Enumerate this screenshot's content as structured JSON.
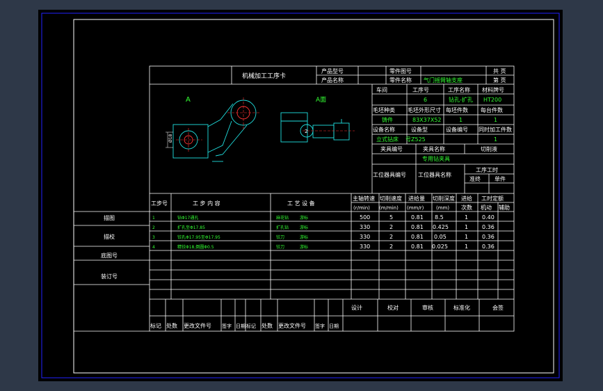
{
  "header": {
    "card_title": "机械加工工序卡",
    "product_model_label": "产品型号",
    "product_name_label": "产品名称",
    "part_no_label": "零件图号",
    "part_name_label": "零件名称",
    "part_name_value": "气门摇臂轴支座",
    "total_pages_label": "共  页",
    "page_no_label": "第  页"
  },
  "info": {
    "workshop_label": "车间",
    "op_no_label": "工序号",
    "op_name_label": "工序名称",
    "material_label": "材料牌号",
    "op_no_value": "6",
    "op_name_value": "钻孔-扩孔",
    "material_value": "HT200",
    "blank_type_label": "毛坯种类",
    "blank_size_label": "毛坯外形尺寸",
    "per_blank_label": "每坯件数",
    "per_unit_label": "每台件数",
    "blank_type_value": "铸件",
    "blank_size_value": "83X37X52",
    "per_blank_value": "1",
    "per_unit_value": "1",
    "equip_name_label": "设备名称",
    "equip_model_label": "设备型",
    "equip_no_label": "设备编号",
    "simul_label": "同时加工件数",
    "equip_name_value": "立式钻床",
    "equip_model_value": "号Z525",
    "simul_value": "1",
    "fixture_no_label": "夹具编号",
    "fixture_name_label": "夹具名称",
    "coolant_label": "切削液",
    "fixture_name_value": "专用钻夹具",
    "station_no_label": "工位器具编号",
    "station_name_label": "工位器具名称",
    "op_time_label": "工序工时",
    "prep_label": "准终",
    "unit_label": "单件"
  },
  "drawing": {
    "view_a_left": "A",
    "view_a_right": "A面",
    "dim_label": "Ø18",
    "mark_2": "2"
  },
  "table": {
    "headers": {
      "step": "工步号",
      "content": "工  步  内  容",
      "equip": "工  艺  设  备",
      "speed": "主轴转速",
      "speed_unit": "(r/min)",
      "cut_speed": "切削速度",
      "cut_speed_unit": "(m/min)",
      "feed": "进给量",
      "feed_unit": "(mm/r)",
      "depth": "切削深度",
      "depth_unit": "(mm)",
      "passes": "进给",
      "passes2": "次数",
      "time": "工时定额",
      "machine": "机动",
      "aux": "辅助"
    },
    "rows": [
      {
        "step": "1",
        "content": "钻Φ17通孔",
        "tool": "麻花钻",
        "gauge": "游标",
        "speed": "500",
        "cut": "5",
        "feed": "0.81",
        "depth": "8.5",
        "passes": "1",
        "time": "0.40"
      },
      {
        "step": "2",
        "content": "扩孔至Φ17.85",
        "tool": "扩孔钻",
        "gauge": "游标",
        "speed": "330",
        "cut": "2",
        "feed": "0.81",
        "depth": "0.425",
        "passes": "1",
        "time": "0.36"
      },
      {
        "step": "3",
        "content": "铰孔Φ17.95至Φ17.95",
        "tool": "铰刀",
        "gauge": "游标",
        "speed": "330",
        "cut": "2",
        "feed": "0.81",
        "depth": "0.05",
        "passes": "1",
        "time": "0.36"
      },
      {
        "step": "4",
        "content": "精铰Φ18,倒圆Φ0.5",
        "tool": "铰刀",
        "gauge": "游标",
        "speed": "330",
        "cut": "2",
        "feed": "0.81",
        "depth": "0.025",
        "passes": "1",
        "time": "0.36"
      }
    ]
  },
  "side_labels": [
    "描图",
    "描校",
    "底图号",
    "装订号"
  ],
  "approval": [
    "设计",
    "校对",
    "审核",
    "标准化",
    "会签"
  ],
  "revision_headers": [
    "标记",
    "处数",
    "更改文件号",
    "签字",
    "日期",
    "标记",
    "处数",
    "更改文件号",
    "签字",
    "日期"
  ]
}
